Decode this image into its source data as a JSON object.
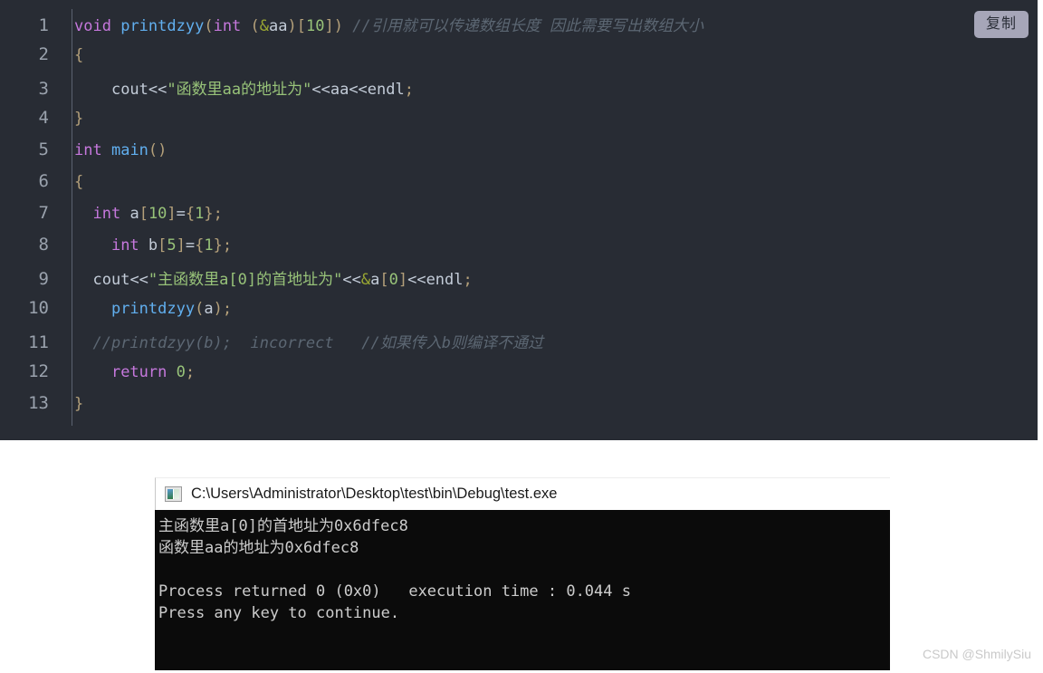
{
  "code_block": {
    "copy_label": "复制",
    "background": "#282c34",
    "language": "cpp",
    "line_numbers": [
      "1",
      "2",
      "3",
      "4",
      "5",
      "6",
      "7",
      "8",
      "9",
      "10",
      "11",
      "12",
      "13"
    ],
    "lines": [
      {
        "num": "1",
        "indent": "",
        "tokens": [
          {
            "t": "kw",
            "v": "void"
          },
          {
            "t": "id",
            "v": " "
          },
          {
            "t": "fn",
            "v": "printdzyy"
          },
          {
            "t": "punc",
            "v": "("
          },
          {
            "t": "kw",
            "v": "int"
          },
          {
            "t": "id",
            "v": " "
          },
          {
            "t": "punc",
            "v": "("
          },
          {
            "t": "amp",
            "v": "&"
          },
          {
            "t": "id",
            "v": "aa"
          },
          {
            "t": "punc",
            "v": ")"
          },
          {
            "t": "punc",
            "v": "["
          },
          {
            "t": "num",
            "v": "10"
          },
          {
            "t": "punc",
            "v": "]"
          },
          {
            "t": "punc",
            "v": ")"
          },
          {
            "t": "id",
            "v": " "
          },
          {
            "t": "cmt",
            "v": "//引用就可以传递数组长度 因此需要写出数组大小"
          }
        ]
      },
      {
        "num": "2",
        "indent": "",
        "tokens": [
          {
            "t": "punc",
            "v": "{"
          }
        ]
      },
      {
        "num": "3",
        "indent": "    ",
        "tokens": [
          {
            "t": "id",
            "v": "cout"
          },
          {
            "t": "op",
            "v": "<<"
          },
          {
            "t": "str",
            "v": "\"函数里aa的地址为\""
          },
          {
            "t": "op",
            "v": "<<"
          },
          {
            "t": "id",
            "v": "aa"
          },
          {
            "t": "op",
            "v": "<<"
          },
          {
            "t": "id",
            "v": "endl"
          },
          {
            "t": "punc",
            "v": ";"
          }
        ]
      },
      {
        "num": "4",
        "indent": "",
        "tokens": [
          {
            "t": "punc",
            "v": "}"
          }
        ]
      },
      {
        "num": "5",
        "indent": "",
        "tokens": [
          {
            "t": "kw",
            "v": "int"
          },
          {
            "t": "id",
            "v": " "
          },
          {
            "t": "fn",
            "v": "main"
          },
          {
            "t": "punc",
            "v": "()"
          }
        ]
      },
      {
        "num": "6",
        "indent": "",
        "tokens": [
          {
            "t": "punc",
            "v": "{"
          }
        ]
      },
      {
        "num": "7",
        "indent": "  ",
        "tokens": [
          {
            "t": "kw",
            "v": "int"
          },
          {
            "t": "id",
            "v": " a"
          },
          {
            "t": "punc",
            "v": "["
          },
          {
            "t": "num",
            "v": "10"
          },
          {
            "t": "punc",
            "v": "]"
          },
          {
            "t": "op",
            "v": "="
          },
          {
            "t": "punc",
            "v": "{"
          },
          {
            "t": "num",
            "v": "1"
          },
          {
            "t": "punc",
            "v": "}"
          },
          {
            "t": "punc",
            "v": ";"
          }
        ]
      },
      {
        "num": "8",
        "indent": "    ",
        "tokens": [
          {
            "t": "kw",
            "v": "int"
          },
          {
            "t": "id",
            "v": " b"
          },
          {
            "t": "punc",
            "v": "["
          },
          {
            "t": "num",
            "v": "5"
          },
          {
            "t": "punc",
            "v": "]"
          },
          {
            "t": "op",
            "v": "="
          },
          {
            "t": "punc",
            "v": "{"
          },
          {
            "t": "num",
            "v": "1"
          },
          {
            "t": "punc",
            "v": "}"
          },
          {
            "t": "punc",
            "v": ";"
          }
        ]
      },
      {
        "num": "9",
        "indent": "  ",
        "tokens": [
          {
            "t": "id",
            "v": "cout"
          },
          {
            "t": "op",
            "v": "<<"
          },
          {
            "t": "str",
            "v": "\"主函数里a[0]的首地址为\""
          },
          {
            "t": "op",
            "v": "<<"
          },
          {
            "t": "amp",
            "v": "&"
          },
          {
            "t": "id",
            "v": "a"
          },
          {
            "t": "punc",
            "v": "["
          },
          {
            "t": "num",
            "v": "0"
          },
          {
            "t": "punc",
            "v": "]"
          },
          {
            "t": "op",
            "v": "<<"
          },
          {
            "t": "id",
            "v": "endl"
          },
          {
            "t": "punc",
            "v": ";"
          }
        ]
      },
      {
        "num": "10",
        "indent": "    ",
        "tokens": [
          {
            "t": "fn",
            "v": "printdzyy"
          },
          {
            "t": "punc",
            "v": "("
          },
          {
            "t": "id",
            "v": "a"
          },
          {
            "t": "punc",
            "v": ")"
          },
          {
            "t": "punc",
            "v": ";"
          }
        ]
      },
      {
        "num": "11",
        "indent": "  ",
        "tokens": [
          {
            "t": "cmt",
            "v": "//printdzyy(b);  incorrect   //如果传入b则编译不通过"
          }
        ]
      },
      {
        "num": "12",
        "indent": "    ",
        "tokens": [
          {
            "t": "kw",
            "v": "return"
          },
          {
            "t": "id",
            "v": " "
          },
          {
            "t": "num",
            "v": "0"
          },
          {
            "t": "punc",
            "v": ";"
          }
        ]
      },
      {
        "num": "13",
        "indent": "",
        "tokens": [
          {
            "t": "punc",
            "v": "}"
          }
        ]
      }
    ]
  },
  "console": {
    "icon": "console-app-icon",
    "title": "C:\\Users\\Administrator\\Desktop\\test\\bin\\Debug\\test.exe",
    "output_lines": [
      "主函数里a[0]的首地址为0x6dfec8",
      "函数里aa的地址为0x6dfec8",
      "",
      "Process returned 0 (0x0)   execution time : 0.044 s",
      "Press any key to continue."
    ],
    "background": "#0b0b0b",
    "text_color": "#cccccc"
  },
  "watermark": {
    "text": "CSDN @ShmilySiu"
  }
}
